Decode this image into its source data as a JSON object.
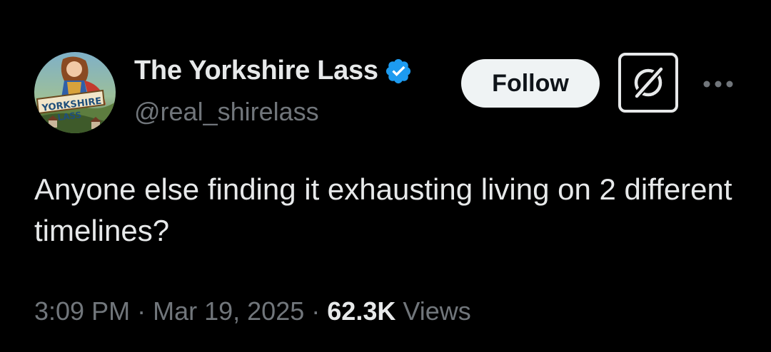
{
  "author": {
    "display_name": "The Yorkshire Lass",
    "handle": "@real_shirelass",
    "verified": true,
    "avatar_text_line1": "YORKSHIRE",
    "avatar_text_line2": "LASS"
  },
  "actions": {
    "follow_label": "Follow",
    "grok_icon": "grok-icon",
    "more_icon": "more-icon"
  },
  "tweet": {
    "text": "Anyone else finding it exhausting living on 2 different timelines?",
    "time": "3:09 PM",
    "separator": "·",
    "date": "Mar 19, 2025",
    "views_count": "62.3K",
    "views_label": "Views"
  },
  "colors": {
    "background": "#000000",
    "primary_text": "#e7e9ea",
    "secondary_text": "#71767b",
    "verified_blue": "#1d9bf0",
    "follow_bg": "#eff3f4"
  }
}
